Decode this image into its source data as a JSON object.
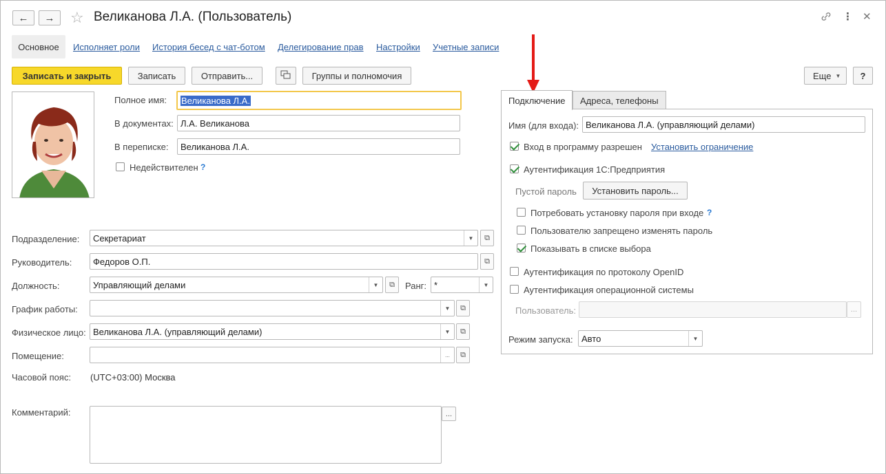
{
  "header": {
    "title": "Великанова Л.А. (Пользователь)",
    "back_label": "🡐",
    "forward_label": "🡒",
    "icons": [
      "star-icon",
      "link-icon",
      "more-icon",
      "close-icon"
    ]
  },
  "nav": {
    "active": "Основное",
    "links": [
      "Исполняет роли",
      "История бесед с чат-ботом",
      "Делегирование прав",
      "Настройки",
      "Учетные записи"
    ]
  },
  "toolbar": {
    "save_close": "Записать и закрыть",
    "save": "Записать",
    "send": "Отправить...",
    "groups": "Группы и полномочия",
    "more": "Еще",
    "help": "?"
  },
  "main": {
    "full_name_label": "Полное имя:",
    "full_name_value": "Великанова Л.А.",
    "in_docs_label": "В документах:",
    "in_docs_value": "Л.А. Великанова",
    "in_mail_label": "В переписке:",
    "in_mail_value": "Великанова Л.А.",
    "invalid_label": "Недействителен",
    "help_mark": "?",
    "department_label": "Подразделение:",
    "department_value": "Секретариат",
    "manager_label": "Руководитель:",
    "manager_value": "Федоров О.П.",
    "position_label": "Должность:",
    "position_value": "Управляющий делами",
    "rank_label": "Ранг:",
    "rank_value": "*",
    "schedule_label": "График работы:",
    "schedule_value": "",
    "person_label": "Физическое лицо:",
    "person_value": "Великанова Л.А. (управляющий делами)",
    "room_label": "Помещение:",
    "room_value": "",
    "timezone_label": "Часовой пояс:",
    "timezone_value": "(UTC+03:00) Москва",
    "comment_label": "Комментарий:",
    "comment_value": ""
  },
  "tabs": {
    "connection": "Подключение",
    "addresses": "Адреса, телефоны"
  },
  "connection": {
    "login_label": "Имя (для входа):",
    "login_value": "Великанова Л.А. (управляющий делами)",
    "access_allowed": "Вход в программу разрешен",
    "set_restriction": "Установить ограничение",
    "auth_1c": "Аутентификация 1С:Предприятия",
    "empty_password": "Пустой пароль",
    "set_password": "Установить пароль...",
    "require_password": "Потребовать установку пароля при входе",
    "forbid_change": "Пользователю запрещено изменять пароль",
    "show_in_list": "Показывать в списке выбора",
    "auth_openid": "Аутентификация по протоколу OpenID",
    "auth_os": "Аутентификация операционной системы",
    "os_user_label": "Пользователь:",
    "os_user_value": "",
    "launch_mode_label": "Режим запуска:",
    "launch_mode_value": "Авто",
    "help_mark": "?"
  },
  "colors": {
    "accent_yellow": "#f7d82a",
    "link_blue": "#2a5b9e",
    "arrow_red": "#e41b17",
    "check_green": "#2f8f3a"
  }
}
